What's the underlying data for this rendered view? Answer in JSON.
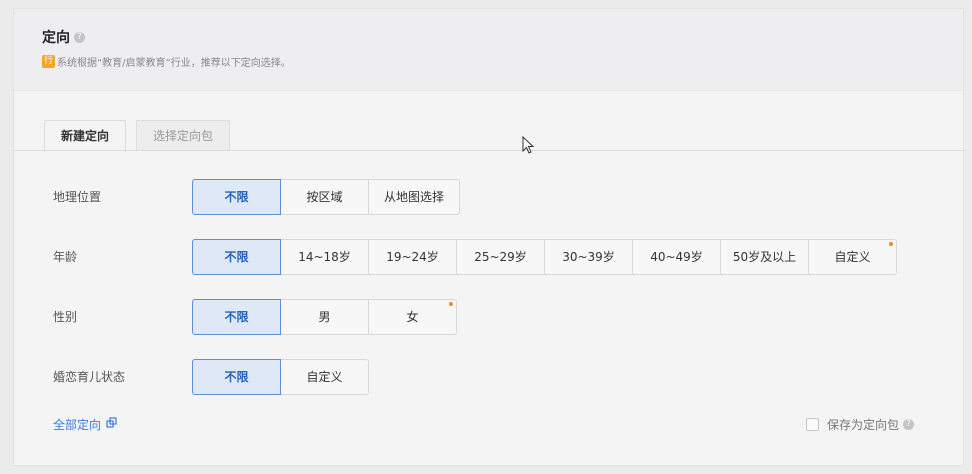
{
  "header": {
    "title": "定向",
    "help_icon": "?",
    "hint_badge": "行",
    "hint": "系统根据“教育/启蒙教育”行业，推荐以下定向选择。"
  },
  "tabs": [
    {
      "label": "新建定向",
      "active": true
    },
    {
      "label": "选择定向包",
      "active": false
    }
  ],
  "rows": {
    "location": {
      "label": "地理位置",
      "options": [
        "不限",
        "按区域",
        "从地图选择"
      ]
    },
    "age": {
      "label": "年龄",
      "options": [
        "不限",
        "14~18岁",
        "19~24岁",
        "25~29岁",
        "30~39岁",
        "40~49岁",
        "50岁及以上",
        "自定义"
      ]
    },
    "gender": {
      "label": "性别",
      "options": [
        "不限",
        "男",
        "女"
      ]
    },
    "marital": {
      "label": "婚恋育儿状态",
      "options": [
        "不限",
        "自定义"
      ]
    }
  },
  "footer": {
    "all_targeting": "全部定向",
    "save_as_package": "保存为定向包",
    "help_icon": "?"
  },
  "colors": {
    "accent": "#2a62b8",
    "selected_bg": "#dfe8f6",
    "dot": "#f08a24",
    "link": "#3a7bd5"
  }
}
